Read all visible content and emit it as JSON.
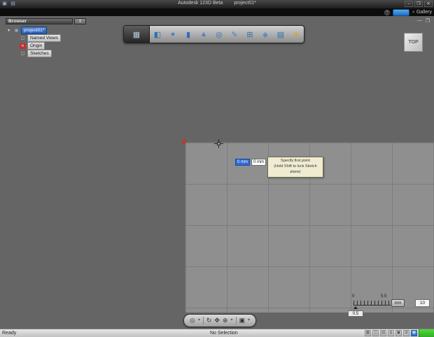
{
  "colors": {
    "selection_blue": "#2a5cb0",
    "input_highlight_blue": "#2e6bd6",
    "tooltip_beige": "#efecd2",
    "icon_blue": "#2f6fb0",
    "signin_blue": "#1e6fc3",
    "status_green": "#2fae22",
    "canvas_gray": "#656565",
    "grid_gray": "#8f8f8f"
  },
  "titlebar": {
    "app_title": "Autodesk 123D Beta",
    "doc_title": "project01*",
    "app_menu_glyph": "▣",
    "save_glyph": "▤",
    "minimize_glyph": "–",
    "maximize_glyph": "❐",
    "close_glyph": "✕"
  },
  "menubar": {
    "help_glyph": "?",
    "search_glyph": "⌕",
    "gallery_label": "Gallery"
  },
  "docwin": {
    "minimize_glyph": "—",
    "restore_glyph": "❐"
  },
  "browser": {
    "header": "Browser",
    "header_btn_glyph": "⇕",
    "expand_glyph": "▾",
    "project_icon_glyph": "▣",
    "folder_icon_glyph": "▢",
    "origin_icon_glyph": "✕",
    "sketch_icon_glyph": "▢",
    "items": [
      {
        "label": "project01*"
      },
      {
        "label": "Named Views"
      },
      {
        "label": "Origin"
      },
      {
        "label": "Sketches"
      }
    ]
  },
  "toolbar": {
    "menu_glyph": "▦",
    "icons": [
      {
        "name": "box",
        "glyph": "◧"
      },
      {
        "name": "sphere",
        "glyph": "●"
      },
      {
        "name": "cylinder",
        "glyph": "▮"
      },
      {
        "name": "cone",
        "glyph": "▲"
      },
      {
        "name": "torus",
        "glyph": "◎"
      },
      {
        "name": "sketch",
        "glyph": "✎"
      },
      {
        "name": "pattern",
        "glyph": "⊞"
      },
      {
        "name": "combine",
        "glyph": "◈"
      },
      {
        "name": "material",
        "glyph": "▤"
      },
      {
        "name": "snap",
        "glyph": "★"
      }
    ]
  },
  "viewcube": {
    "label": "TOP"
  },
  "sketch": {
    "input_x": "0 mm",
    "input_y": "0 mm",
    "tooltip_line1": "Specify first point",
    "tooltip_line2": "(Hold Shift to lock Sketch plane)"
  },
  "ruler": {
    "start_label": "0",
    "end_label": "5.5",
    "step_value": "0.5",
    "unit_label": "mm",
    "scale_value": "10"
  },
  "bottom_toolbar": {
    "icons": [
      {
        "name": "select-tool",
        "glyph": "◎"
      },
      {
        "name": "select-dropdown",
        "glyph": "▾"
      },
      {
        "name": "orbit-tool",
        "glyph": "↻"
      },
      {
        "name": "pan-tool",
        "glyph": "✥"
      },
      {
        "name": "zoom-tool",
        "glyph": "⊕"
      },
      {
        "name": "view-dropdown",
        "glyph": "▾"
      },
      {
        "name": "camera-tool",
        "glyph": "▣"
      },
      {
        "name": "camera-dropdown",
        "glyph": "▾"
      }
    ]
  },
  "statusbar": {
    "left": "Ready",
    "selection": "No Selection",
    "icons": [
      {
        "name": "status-grid",
        "glyph": "▦"
      },
      {
        "name": "status-snap",
        "glyph": "◫"
      },
      {
        "name": "status-ortho",
        "glyph": "▤"
      },
      {
        "name": "status-units",
        "glyph": "◍"
      },
      {
        "name": "status-layers",
        "glyph": "▣"
      },
      {
        "name": "status-history",
        "glyph": "⊞"
      },
      {
        "name": "status-sync",
        "glyph": "◈"
      }
    ]
  }
}
